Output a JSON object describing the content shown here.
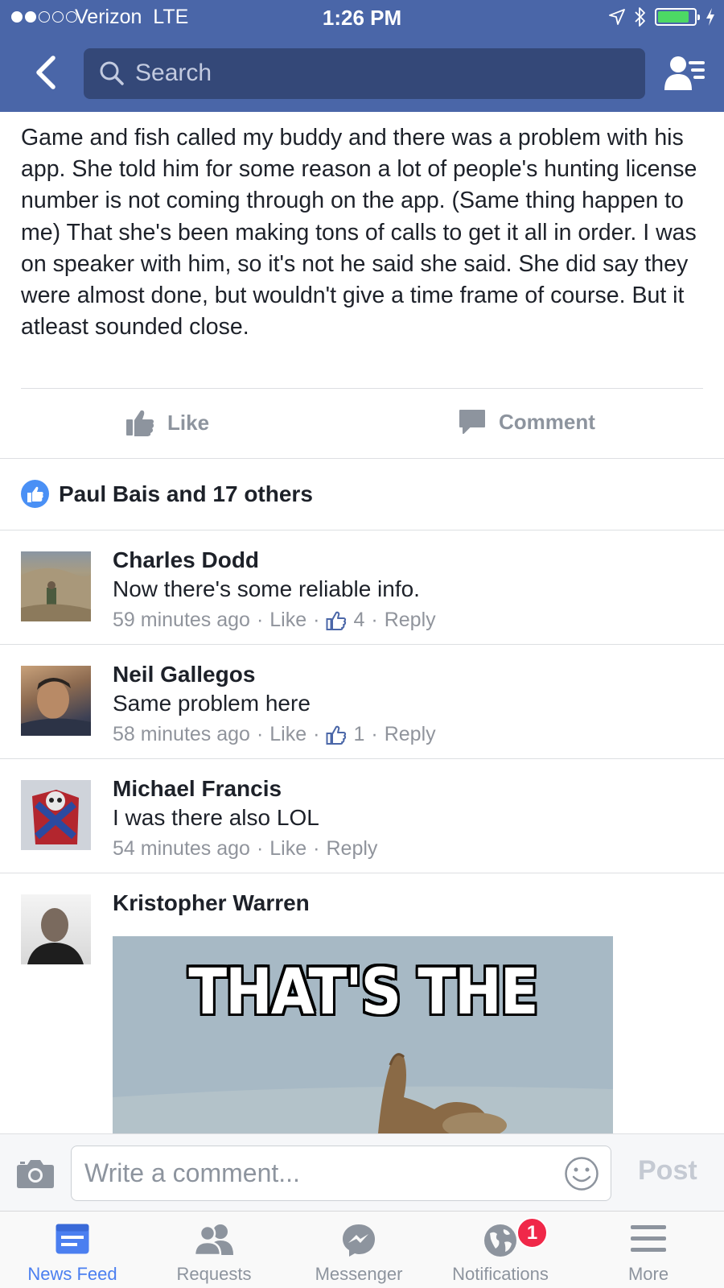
{
  "status_bar": {
    "carrier": "Verizon",
    "network": "LTE",
    "time": "1:26 PM",
    "signal_bars_filled": 2,
    "signal_bars_total": 5,
    "battery_level": 0.86
  },
  "nav": {
    "search_placeholder": "Search"
  },
  "post": {
    "text": "Game and fish called my buddy and there was a problem with his app. She told him for some reason a lot of people's hunting license number is not coming through on the app. (Same thing happen to me) That she's been making tons of calls to get it all in order. I was on speaker with him, so it's not he said she said. She did say they were almost done, but wouldn't give a time frame of course. But it atleast sounded close.",
    "like_label": "Like",
    "comment_label": "Comment",
    "reactions_summary": "Paul Bais and 17 others"
  },
  "comments": [
    {
      "name": "Charles Dodd",
      "text": "Now there's some reliable info.",
      "time": "59 minutes ago",
      "like": "Like",
      "likes": "4",
      "reply": "Reply"
    },
    {
      "name": "Neil Gallegos",
      "text": "Same problem here",
      "time": "58 minutes ago",
      "like": "Like",
      "likes": "1",
      "reply": "Reply"
    },
    {
      "name": "Michael Francis",
      "text": "I was there also LOL",
      "time": "54 minutes ago",
      "like": "Like",
      "reply": "Reply"
    },
    {
      "name": "Kristopher Warren",
      "meme_text": "THAT'S THE"
    }
  ],
  "composer": {
    "placeholder": "Write a comment...",
    "post_label": "Post"
  },
  "tabs": [
    {
      "label": "News Feed",
      "icon": "news-feed-icon",
      "active": true
    },
    {
      "label": "Requests",
      "icon": "requests-icon"
    },
    {
      "label": "Messenger",
      "icon": "messenger-icon"
    },
    {
      "label": "Notifications",
      "icon": "notifications-globe-icon",
      "badge": "1"
    },
    {
      "label": "More",
      "icon": "more-menu-icon"
    }
  ],
  "colors": {
    "brand_blue": "#4a66a8",
    "search_bg": "#344878",
    "active_tab": "#4b7ff0",
    "badge_red": "#f02849",
    "meta_gray": "#90949c"
  }
}
